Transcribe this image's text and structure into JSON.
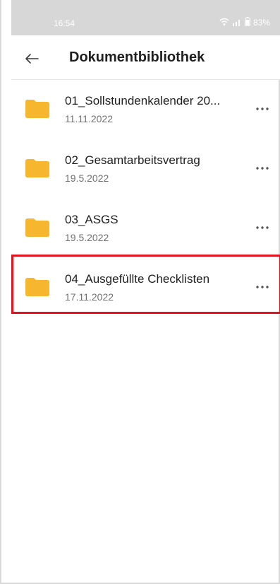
{
  "status_bar": {
    "time": "16:54",
    "battery": "83%"
  },
  "header": {
    "title": "Dokumentbibliothek"
  },
  "documents": [
    {
      "title": "01_Sollstundenkalender 20...",
      "date": "11.11.2022"
    },
    {
      "title": "02_Gesamtarbeitsvertrag",
      "date": "19.5.2022"
    },
    {
      "title": "03_ASGS",
      "date": "19.5.2022"
    },
    {
      "title": "04_Ausgefüllte Checklisten",
      "date": "17.11.2022"
    }
  ],
  "colors": {
    "folder": "#f6b72e",
    "highlight": "#e0141e",
    "status_bar": "#d7d7d7"
  },
  "icons": {
    "back": "arrow-left-icon",
    "folder": "folder-icon",
    "more": "more-horizontal-icon",
    "wifi": "wifi-icon",
    "signal": "signal-icon",
    "battery": "battery-icon"
  }
}
